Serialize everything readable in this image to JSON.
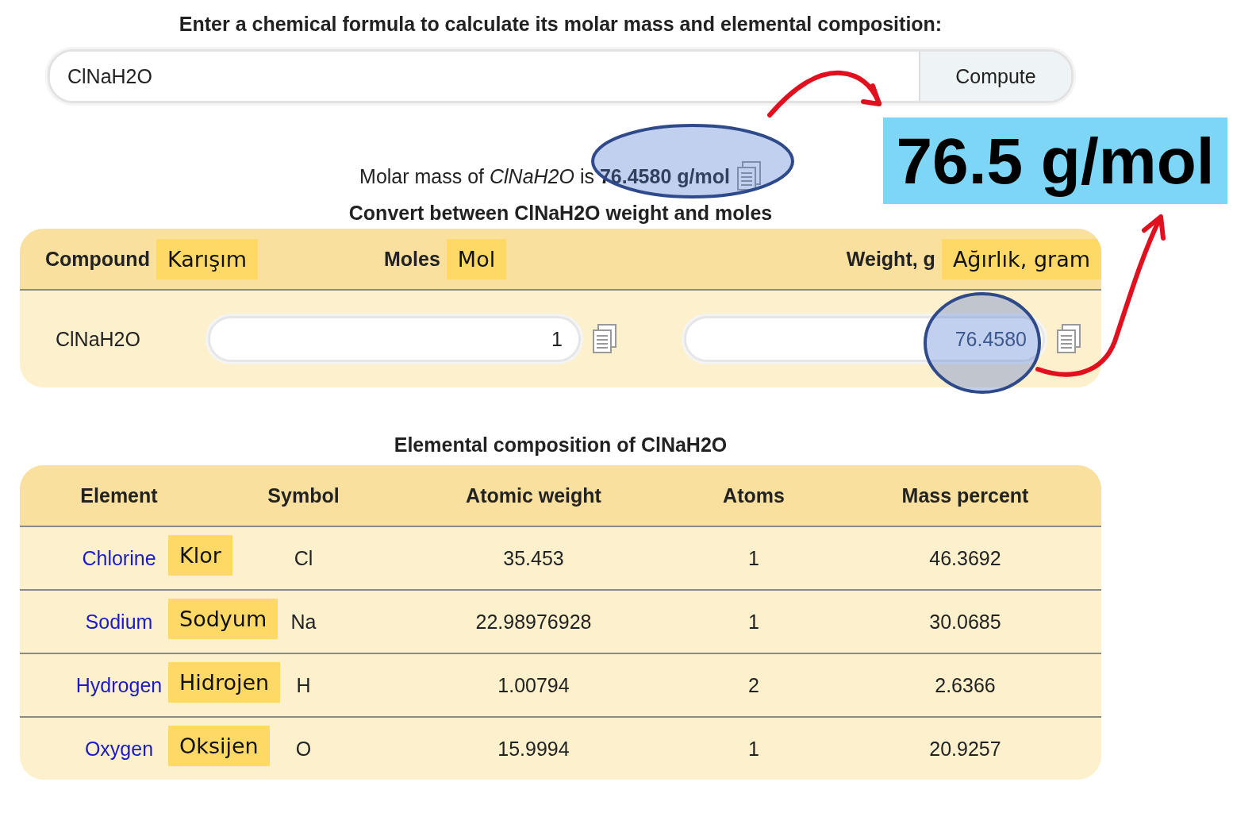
{
  "prompt": "Enter a chemical formula to calculate its molar mass and elemental composition:",
  "formula_input": {
    "value": "ClNaH2O"
  },
  "compute_button": "Compute",
  "result": "Molar mass of *ClNaH2O* is **76.4580 g/mol**",
  "convert_title": "Convert between ClNaH2O weight and moles",
  "convert_table": {
    "columns": [
      {
        "label": "Compound",
        "translation": "Karışım"
      },
      {
        "label": "Moles",
        "translation": "Mol"
      },
      {
        "label": "Weight, g",
        "translation": "Ağırlık, gram"
      }
    ],
    "row": {
      "compound": "ClNaH2O",
      "moles": "1",
      "weight": "76.4580"
    }
  },
  "composition_title": "Elemental composition of ClNaH2O",
  "composition_table": {
    "columns": [
      "Element",
      "Symbol",
      "Atomic weight",
      "Atoms",
      "Mass percent"
    ],
    "rows": [
      {
        "element": "Chlorine",
        "translation": "Klor",
        "symbol": "Cl",
        "atomic_weight": "35.453",
        "atoms": "1",
        "mass_percent": "46.3692"
      },
      {
        "element": "Sodium",
        "translation": "Sodyum",
        "symbol": "Na",
        "atomic_weight": "22.98976928",
        "atoms": "1",
        "mass_percent": "30.0685"
      },
      {
        "element": "Hydrogen",
        "translation": "Hidrojen",
        "symbol": "H",
        "atomic_weight": "1.00794",
        "atoms": "2",
        "mass_percent": "2.6366"
      },
      {
        "element": "Oxygen",
        "translation": "Oksijen",
        "symbol": "O",
        "atomic_weight": "15.9994",
        "atoms": "1",
        "mass_percent": "20.9257"
      }
    ]
  },
  "callout": "76.5 g/mol"
}
